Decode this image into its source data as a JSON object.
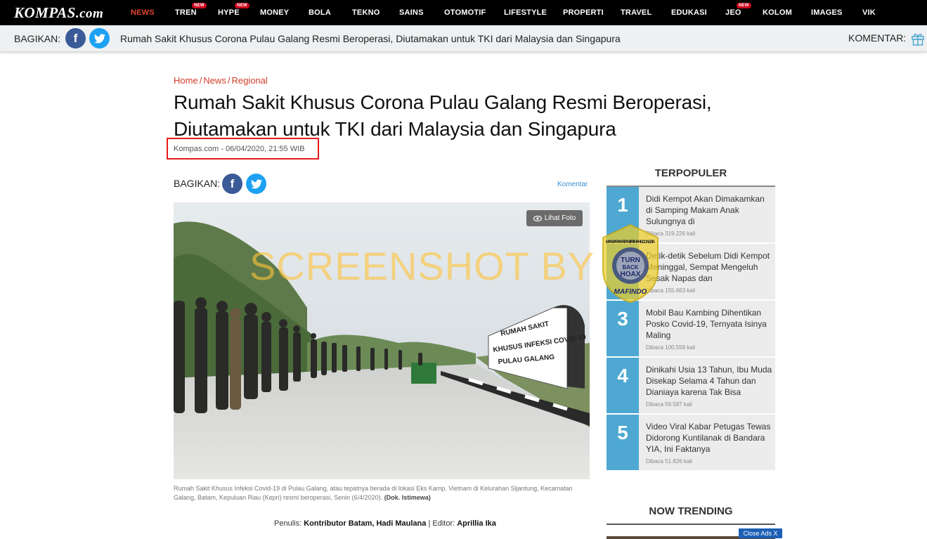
{
  "topnav": {
    "logo_main": "KOMPAS",
    "logo_suffix": ".com",
    "items": [
      {
        "label": "NEWS",
        "active": true,
        "badge": ""
      },
      {
        "label": "TREN",
        "active": false,
        "badge": "NEW"
      },
      {
        "label": "HYPE",
        "active": false,
        "badge": "NEW"
      },
      {
        "label": "MONEY",
        "active": false,
        "badge": ""
      },
      {
        "label": "BOLA",
        "active": false,
        "badge": ""
      },
      {
        "label": "TEKNO",
        "active": false,
        "badge": ""
      },
      {
        "label": "SAINS",
        "active": false,
        "badge": ""
      },
      {
        "label": "OTOMOTIF",
        "active": false,
        "badge": ""
      },
      {
        "label": "LIFESTYLE",
        "active": false,
        "badge": ""
      },
      {
        "label": "PROPERTI",
        "active": false,
        "badge": ""
      },
      {
        "label": "TRAVEL",
        "active": false,
        "badge": ""
      },
      {
        "label": "EDUKASI",
        "active": false,
        "badge": ""
      },
      {
        "label": "JEO",
        "active": false,
        "badge": "NEW"
      },
      {
        "label": "KOLOM",
        "active": false,
        "badge": ""
      },
      {
        "label": "IMAGES",
        "active": false,
        "badge": ""
      },
      {
        "label": "VIK",
        "active": false,
        "badge": ""
      }
    ]
  },
  "sharebar": {
    "label": "BAGIKAN:",
    "title": "Rumah Sakit Khusus Corona Pulau Galang Resmi Beroperasi, Diutamakan untuk TKI dari Malaysia dan Singapura",
    "komentar": "KOMENTAR:"
  },
  "article": {
    "breadcrumb": [
      "Home",
      "News",
      "Regional"
    ],
    "headline": "Rumah Sakit Khusus Corona Pulau Galang Resmi Beroperasi, Diutamakan untuk TKI dari Malaysia dan Singapura",
    "dateline": "Kompas.com - 06/04/2020, 21:55 WIB",
    "share_label": "BAGIKAN:",
    "komentar_link": "Komentar",
    "lihat_foto": "Lihat Foto",
    "watermark": "SCREENSHOT BY",
    "banner_lines": [
      "RUMAH SAKIT",
      "KHUSUS INFEKSI COVID-19",
      "PULAU GALANG"
    ],
    "caption": "Rumah Sakit Khusus Infeksi Covid-19 di Pulau Galang, atau tepatnya berada di lokasi Eks Kamp. Vietnam di Kelurahan Sijantung, Kecamatan Galang, Batam, Kepuluan Riau (Kepri) resmi beroperasi, Senin (6/4/2020).",
    "caption_credit": "(Dok. Istimewa)",
    "byline": {
      "penulis_label": "Penulis:",
      "penulis": "Kontributor Batam, Hadi Maulana",
      "editor_label": "| Editor:",
      "editor": "Aprillia Ika"
    }
  },
  "sidebar": {
    "popular_heading": "TERPOPULER",
    "popular": [
      {
        "rank": "1",
        "title": "Didi Kempot Akan Dimakamkan di Samping Makam Anak Sulungnya di",
        "views": "Dibaca 319.226 kali"
      },
      {
        "rank": "2",
        "title": "Detik-detik Sebelum Didi Kempot Meninggal, Sempat Mengeluh Sesak Napas dan",
        "views": "Dibaca 155.663 kali"
      },
      {
        "rank": "3",
        "title": "Mobil Bau Kambing Dihentikan Posko Covid-19, Ternyata Isinya Maling",
        "views": "Dibaca 100.558 kali"
      },
      {
        "rank": "4",
        "title": "Dinikahi Usia 13 Tahun, Ibu Muda Disekap Selama 4 Tahun dan Dianiaya karena Tak Bisa",
        "views": "Dibaca 59.587 kali"
      },
      {
        "rank": "5",
        "title": "Video Viral Kabar Petugas Tewas Didorong Kuntilanak di Bandara YIA, Ini Faktanya",
        "views": "Dibaca 51.826 kali"
      }
    ],
    "trending_heading": "NOW TRENDING",
    "close_ads": "Close Ads X"
  },
  "stamp": {
    "ring_text": "MASYARAKAT ANTI FITNAH INDONESIA",
    "center_lines": [
      "TURN",
      "BACK",
      "HOAX"
    ],
    "bottom": "MAFINDO"
  },
  "colors": {
    "nav_bg": "#000000",
    "nav_active": "#e0452d",
    "breadcrumb": "#cf3d27",
    "rank_bg": "#4ea8d2",
    "highlight_box": "#e61b1b"
  }
}
